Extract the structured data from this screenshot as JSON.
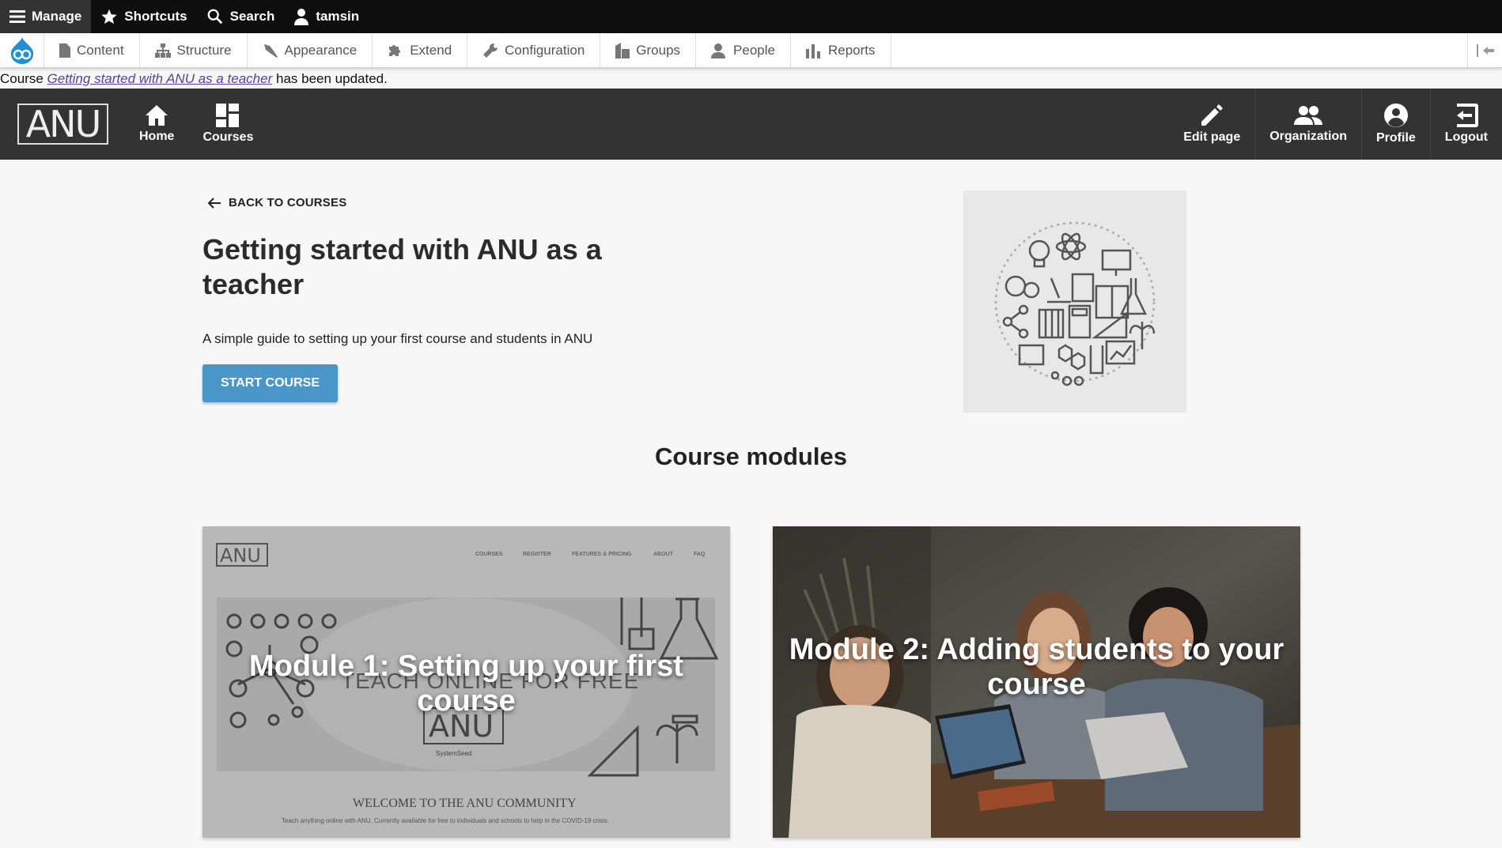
{
  "admin_toolbar": {
    "manage": "Manage",
    "shortcuts": "Shortcuts",
    "search": "Search",
    "user": "tamsin"
  },
  "admin_tray": {
    "items": [
      {
        "label": "Content",
        "icon": "file-icon"
      },
      {
        "label": "Structure",
        "icon": "sitemap-icon"
      },
      {
        "label": "Appearance",
        "icon": "brush-icon"
      },
      {
        "label": "Extend",
        "icon": "puzzle-icon"
      },
      {
        "label": "Configuration",
        "icon": "wrench-icon"
      },
      {
        "label": "Groups",
        "icon": "building-icon"
      },
      {
        "label": "People",
        "icon": "person-icon"
      },
      {
        "label": "Reports",
        "icon": "bar-chart-icon"
      }
    ]
  },
  "status_message": {
    "prefix": "Course ",
    "link_text": "Getting started with ANU as a teacher",
    "suffix": " has been updated."
  },
  "site_header": {
    "logo_text": "ANU",
    "nav_left": [
      {
        "label": "Home",
        "icon": "home-icon"
      },
      {
        "label": "Courses",
        "icon": "grid-icon"
      }
    ],
    "nav_right": [
      {
        "label": "Edit page",
        "icon": "pencil-icon"
      },
      {
        "label": "Organization",
        "icon": "people-icon"
      },
      {
        "label": "Profile",
        "icon": "account-circle-icon"
      },
      {
        "label": "Logout",
        "icon": "logout-icon"
      }
    ]
  },
  "course": {
    "back_label": "BACK TO COURSES",
    "title": "Getting started with ANU as a teacher",
    "description": "A simple guide to setting up your first course and students in ANU",
    "start_button": "START COURSE"
  },
  "modules": {
    "heading": "Course modules",
    "items": [
      {
        "title": "Module 1: Setting up your first course"
      },
      {
        "title": "Module 2: Adding students to your course"
      }
    ]
  },
  "colors": {
    "admin_bar": "#0f0f0f",
    "site_header": "#333333",
    "primary_button": "#4a96c9",
    "page_background": "#f7f7f7"
  }
}
